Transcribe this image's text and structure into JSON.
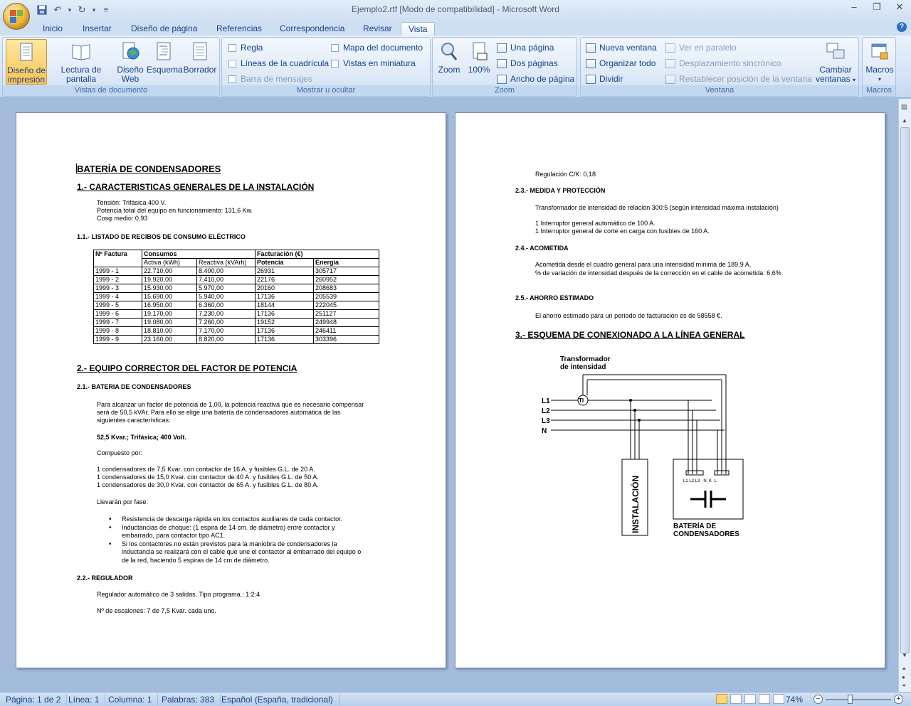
{
  "window": {
    "title": "Ejemplo2.rtf [Modo de compatibilidad] - Microsoft Word"
  },
  "tabs": [
    "Inicio",
    "Insertar",
    "Diseño de página",
    "Referencias",
    "Correspondencia",
    "Revisar",
    "Vista"
  ],
  "active_tab": "Vista",
  "ribbon": {
    "vistas": {
      "label": "Vistas de documento",
      "buttons": [
        {
          "l1": "Diseño de",
          "l2": "impresión"
        },
        {
          "l1": "Lectura de",
          "l2": "pantalla completa"
        },
        {
          "l1": "Diseño",
          "l2": "Web"
        },
        {
          "l1": "Esquema",
          "l2": ""
        },
        {
          "l1": "Borrador",
          "l2": ""
        }
      ]
    },
    "mostrar": {
      "label": "Mostrar u ocultar",
      "items": [
        "Regla",
        "Líneas de la cuadrícula",
        "Barra de mensajes",
        "Mapa del documento",
        "Vistas en miniatura"
      ]
    },
    "zoom": {
      "label": "Zoom",
      "zoom": "Zoom",
      "pct": "100%",
      "una": "Una página",
      "dos": "Dos páginas",
      "ancho": "Ancho de página"
    },
    "ventana": {
      "label": "Ventana",
      "nueva": "Nueva ventana",
      "organizar": "Organizar todo",
      "dividir": "Dividir",
      "paralelo": "Ver en paralelo",
      "desplaz": "Desplazamiento sincrónico",
      "restablecer": "Restablecer posición de la ventana",
      "cambiar1": "Cambiar",
      "cambiar2": "ventanas"
    },
    "macros": {
      "label": "Macros",
      "btn": "Macros"
    }
  },
  "page1": {
    "title": "BATERÍA DE CONDENSADORES",
    "s1": "1.- CARACTERISTICAS GENERALES DE LA INSTALACIÓN",
    "s1_lines": [
      "Tensión: Trifásica 400 V.",
      "Potencia total del equipo en funcionamiento: 131,6 Kw.",
      "Cosφ medio: 0,93"
    ],
    "s11": "1.1.- LISTADO DE RECIBOS DE CONSUMO ELÉCTRICO",
    "table": {
      "h1": [
        "Nº Factura",
        "Consumos",
        "Facturación (€)"
      ],
      "h2": [
        "Activa (kWh)",
        "Reactiva (kVArh)",
        "Potencia",
        "Energía"
      ],
      "rows": [
        [
          "1999 - 1",
          "22.710,00",
          "8.400,00",
          "26931",
          "305717"
        ],
        [
          "1999 - 2",
          "19.920,00",
          "7.410,00",
          "22176",
          "260952"
        ],
        [
          "1999 - 3",
          "15.930,00",
          "5.970,00",
          "20160",
          "208683"
        ],
        [
          "1999 - 4",
          "15.690,00",
          "5.940,00",
          "17136",
          "205539"
        ],
        [
          "1999 - 5",
          "16.950,00",
          "6.360,00",
          "18144",
          "222045"
        ],
        [
          "1999 - 6",
          "19.170,00",
          "7.230,00",
          "17136",
          "251127"
        ],
        [
          "1999 - 7",
          "19.080,00",
          "7.260,00",
          "19152",
          "249948"
        ],
        [
          "1999 - 8",
          "18.810,00",
          "7.170,00",
          "17136",
          "246411"
        ],
        [
          "1999 - 9",
          "23.160,00",
          "8.820,00",
          "17136",
          "303396"
        ]
      ]
    },
    "s2": "2.- EQUIPO CORRECTOR DEL FACTOR DE POTENCIA",
    "s21": "2.1.- BATERIA DE CONDENSADORES",
    "s21_para": [
      "Para alcanzar un factor de potencia de 1,00, la potencia reactiva que es necesario compensar",
      "será de 50,5 kVAr. Para ello se elige una batería de condensadores automática de las",
      "siguientes características:"
    ],
    "s21_bold": "52,5 Kvar.; Trifásica; 400 Volt.",
    "compuesto": "Compuesto por:",
    "cond": [
      "1 condensadores de 7,5 Kvar. con contactor de 16 A.  y fusibles G.L. de 20 A.",
      "1 condensadores de 15,0 Kvar. con contactor de 40 A.  y fusibles G.L. de 50 A.",
      "1 condensadores de 30,0 Kvar. con contactor de 65 A.  y fusibles G.L. de 80 A."
    ],
    "llevaran": "Llevarán por fase:",
    "bullets": [
      [
        "Resistencia de descarga rápida en los contactos auxiliares de cada contactor."
      ],
      [
        "Inductancias de choque: (1 espira de 14 cm. de diámetro) entre contactor y",
        "embarrado, para contactor tipo AC1."
      ],
      [
        "Si los contactores no están previstos para la maniobra de condensadores la",
        "inductancia se realizará con el cable que une el contactor al embarrado del equipo o",
        "de la red, haciendo 5 espiras de 14 cm de diámetro."
      ]
    ],
    "s22": "2.2.- REGULADOR",
    "reg1": "Regulador automático de 3 salidas. Tipo programa.: 1:2:4",
    "reg2": "Nº de escalones: 7 de 7,5 Kvar. cada uno."
  },
  "page2": {
    "reg": "Regulación C/K: 0,18",
    "s23": "2.3.- MEDIDA Y PROTECCIÓN",
    "s23_l1": "Transformador de intensidad de relación 300:5 (según intensidad máxima instalación)",
    "s23_l2": "1 Interruptor general automático de 100 A.",
    "s23_l3": "1 Interruptor general de corte en carga con fusibles de 160 A.",
    "s24": "2.4.- ACOMETIDA",
    "s24_l1": "Acometida desde el cuadro general para una intensidad mínima de 189,9 A.",
    "s24_l2": "% de variación de intensidad después de la corrección en el cable de acometida: 6,6%",
    "s25": "2.5.- AHORRO ESTIMADO",
    "s25_l1": "El ahorro estimado para un período de facturación es de 58558 €.",
    "s3": "3.- ESQUEMA DE CONEXIONADO A LA LÍNEA GENERAL",
    "diagram": {
      "t1": "Transformador",
      "t2": "de intensidad",
      "ti": "TI",
      "l1": "L1",
      "l2": "L2",
      "l3": "L3",
      "n": "N",
      "inst": "INSTALACIÓN",
      "terms": "L1 L2 L3   N  K  L",
      "bat1": "BATERÍA DE",
      "bat2": "CONDENSADORES"
    }
  },
  "status": {
    "pagina": "Página: 1 de 2",
    "linea": "Línea: 1",
    "columna": "Columna: 1",
    "palabras": "Palabras: 383",
    "idioma": "Español (España, tradicional)",
    "zoom": "74%"
  }
}
